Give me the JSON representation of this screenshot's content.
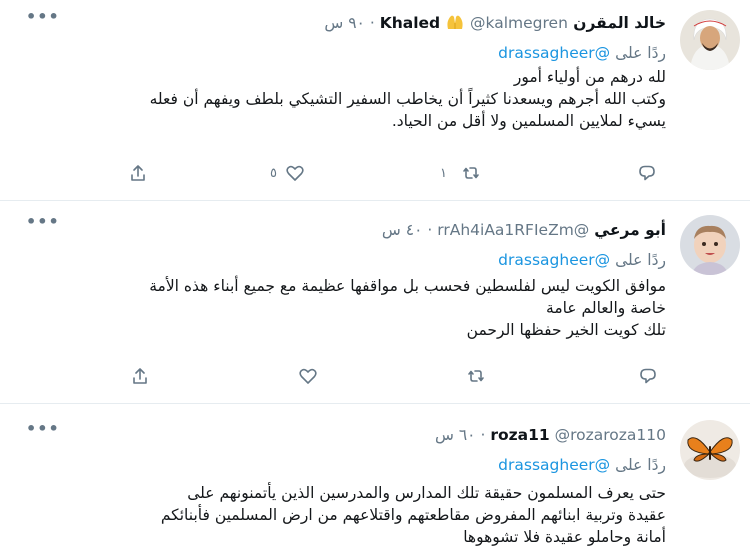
{
  "tweets": [
    {
      "name": "خالد المقرن Khaled",
      "handle": "@kalmegren",
      "time": "٩٠ س",
      "reply_prefix": "ردًا على",
      "reply_to": "@drassagheer",
      "lines": [
        "لله درهم من أولياء أمور",
        "وكتب الله أجرهم ويسعدنا كثيراً أن يخاطب السفير التشيكي بلطف ويفهم أن فعله",
        "يسيء لملايين المسلمين ولا أقل من الحياد."
      ],
      "retweets": "١",
      "likes": "٥"
    },
    {
      "name": "أبو مرعي",
      "handle": "@rrAh4iAa1RFIeZm",
      "time": "٤٠ س",
      "reply_prefix": "ردًا على",
      "reply_to": "@drassagheer",
      "lines": [
        "موافق الكويت ليس لفلسطين فحسب بل مواقفها عظيمة مع جميع أبناء هذه الأمة",
        "خاصة والعالم عامة",
        "تلك كويت الخير حفظها الرحمن"
      ],
      "retweets": "",
      "likes": ""
    },
    {
      "name": "roza11",
      "handle": "@rozaroza110",
      "time": "٦٠ س",
      "reply_prefix": "ردًا على",
      "reply_to": "@drassagheer",
      "lines": [
        "حتى يعرف المسلمون  حقيقة تلك المدارس والمدرسين الذين يأتمنونهم على",
        "عقيدة وتربية ابنائهم المفروض مقاطعتهم واقتلاعهم من ارض المسلمين فأبنائكم",
        "أمانة وحاملو عقيدة فلا تشوهوها"
      ]
    }
  ],
  "icons": {
    "reply": "reply-icon",
    "retweet": "retweet-icon",
    "like": "heart-icon",
    "share": "share-icon",
    "more": "more-icon"
  },
  "colors": {
    "link": "#1b95e0",
    "muted": "#657786",
    "divider": "#e6ecf0"
  }
}
